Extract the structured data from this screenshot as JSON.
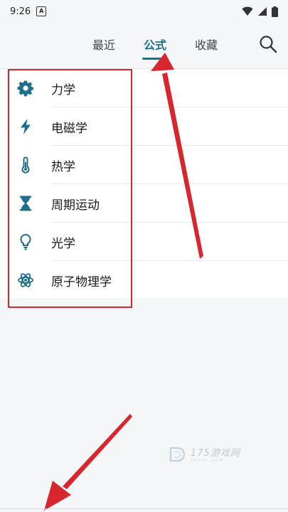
{
  "status_bar": {
    "time": "9:26",
    "badge": "A"
  },
  "tabs": [
    {
      "label": "最近",
      "active": false
    },
    {
      "label": "公式",
      "active": true
    },
    {
      "label": "收藏",
      "active": false
    }
  ],
  "categories": [
    {
      "label": "力学",
      "icon": "gear-icon"
    },
    {
      "label": "电磁学",
      "icon": "lightning-icon"
    },
    {
      "label": "热学",
      "icon": "thermometer-icon"
    },
    {
      "label": "周期运动",
      "icon": "hourglass-icon"
    },
    {
      "label": "光学",
      "icon": "lightbulb-icon"
    },
    {
      "label": "原子物理学",
      "icon": "atom-icon"
    }
  ],
  "watermark": {
    "text": "175游戏网",
    "sub": "YOUXI.COM"
  },
  "colors": {
    "accent": "#1e6f8c",
    "annotation": "#d8262e",
    "background": "#f4f6f8"
  }
}
